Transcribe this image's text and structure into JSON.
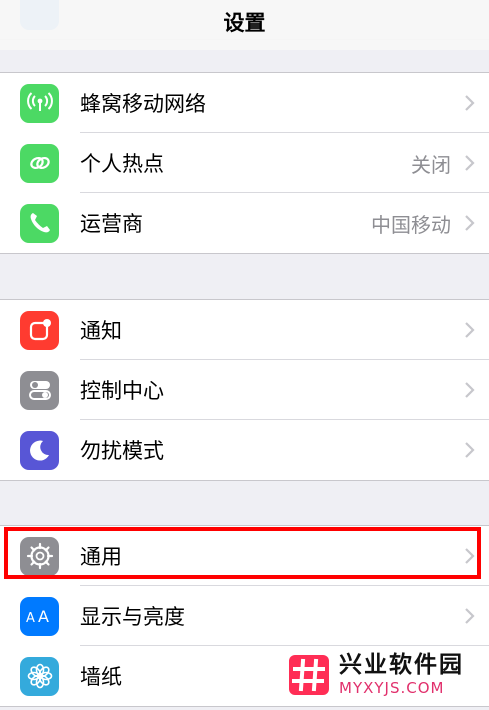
{
  "navbar": {
    "title": "设置"
  },
  "group_top": {
    "rows": [
      {
        "label": "蜂窝移动网络",
        "value": "",
        "icon": "cellular-antenna-icon",
        "color": "#4cd964"
      },
      {
        "label": "个人热点",
        "value": "关闭",
        "icon": "hotspot-link-icon",
        "color": "#4cd964"
      },
      {
        "label": "运营商",
        "value": "中国移动",
        "icon": "phone-icon",
        "color": "#4cd964"
      }
    ]
  },
  "group_notify": {
    "rows": [
      {
        "label": "通知",
        "value": "",
        "icon": "notification-icon",
        "color": "#ff3b30"
      },
      {
        "label": "控制中心",
        "value": "",
        "icon": "control-center-icon",
        "color": "#8e8e93"
      },
      {
        "label": "勿扰模式",
        "value": "",
        "icon": "moon-icon",
        "color": "#5856d6"
      }
    ]
  },
  "group_general": {
    "rows": [
      {
        "label": "通用",
        "value": "",
        "icon": "gear-icon",
        "color": "#8e8e93"
      },
      {
        "label": "显示与亮度",
        "value": "",
        "icon": "text-size-icon",
        "color": "#007aff"
      },
      {
        "label": "墙纸",
        "value": "",
        "icon": "flower-icon",
        "color": "#34aadc"
      }
    ]
  },
  "watermark": {
    "cn": "兴业软件园",
    "en": "MYXYJS.COM"
  }
}
